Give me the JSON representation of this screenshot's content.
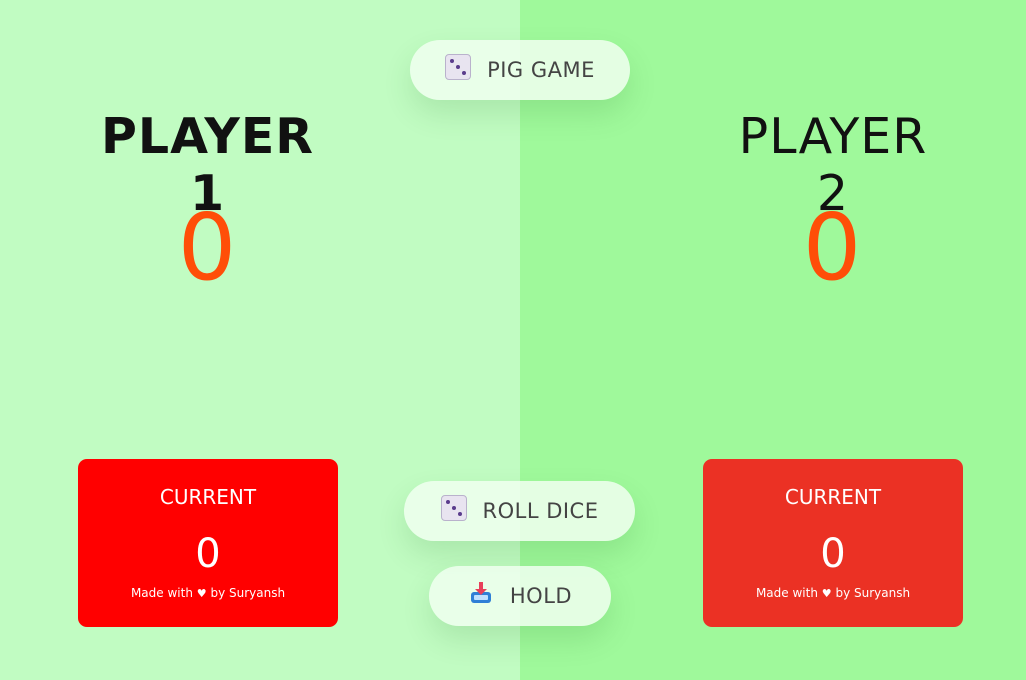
{
  "colors": {
    "left_background": "#c1fcc2",
    "right_background": "#9ff99b",
    "score_color": "#ff4e08",
    "player1_current_bg": "#ff0000",
    "player2_current_bg": "#eb3124"
  },
  "buttons": {
    "new_game": {
      "label": "PIG GAME",
      "icon": "dice-icon"
    },
    "roll": {
      "label": "ROLL DICE",
      "icon": "dice-icon"
    },
    "hold": {
      "label": "HOLD",
      "icon": "inbox-tray-icon"
    }
  },
  "players": [
    {
      "name": "PLAYER 1",
      "score": "0",
      "current_label": "CURRENT",
      "current_score": "0",
      "credit_prefix": "Made with",
      "credit_heart": "♥",
      "credit_suffix": "by Suryansh"
    },
    {
      "name": "PLAYER 2",
      "score": "0",
      "current_label": "CURRENT",
      "current_score": "0",
      "credit_prefix": "Made with",
      "credit_heart": "♥",
      "credit_suffix": "by Suryansh"
    }
  ]
}
